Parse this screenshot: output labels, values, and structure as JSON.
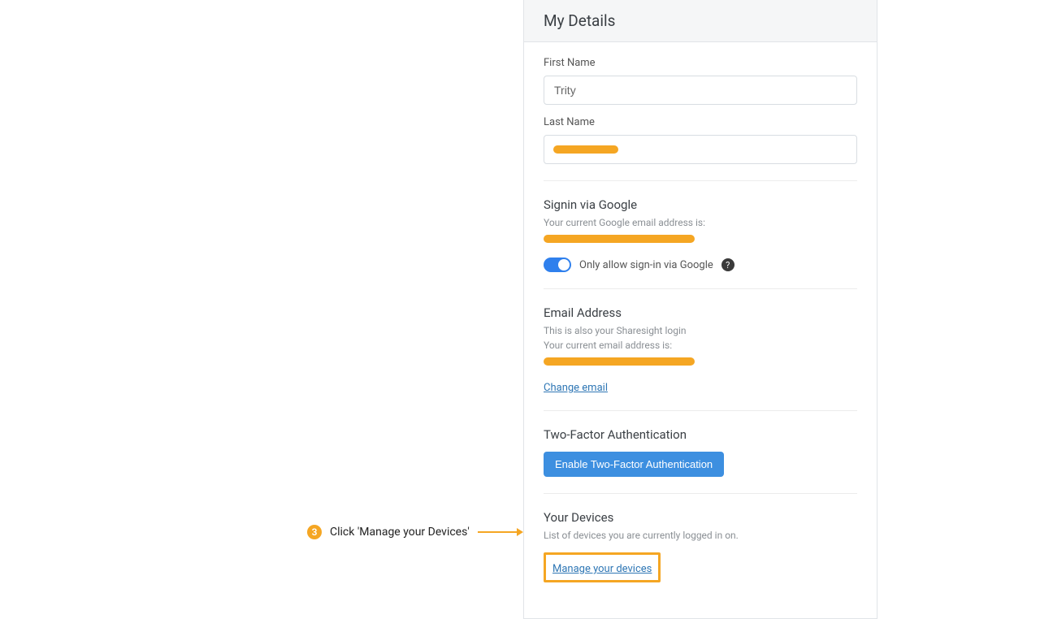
{
  "panel": {
    "title": "My Details",
    "firstName": {
      "label": "First Name",
      "value": "Trity"
    },
    "lastName": {
      "label": "Last Name"
    },
    "google": {
      "heading": "Signin via Google",
      "currentLabel": "Your current Google email address is:",
      "toggleLabel": "Only allow sign-in via Google"
    },
    "email": {
      "heading": "Email Address",
      "sub1": "This is also your Sharesight login",
      "sub2": "Your current email address is:",
      "changeLink": "Change email"
    },
    "twofa": {
      "heading": "Two-Factor Authentication",
      "button": "Enable Two-Factor Authentication"
    },
    "devices": {
      "heading": "Your Devices",
      "sub": "List of devices you are currently logged in on.",
      "link": "Manage your devices"
    }
  },
  "annotation": {
    "step": "3",
    "text": "Click 'Manage your Devices'"
  }
}
